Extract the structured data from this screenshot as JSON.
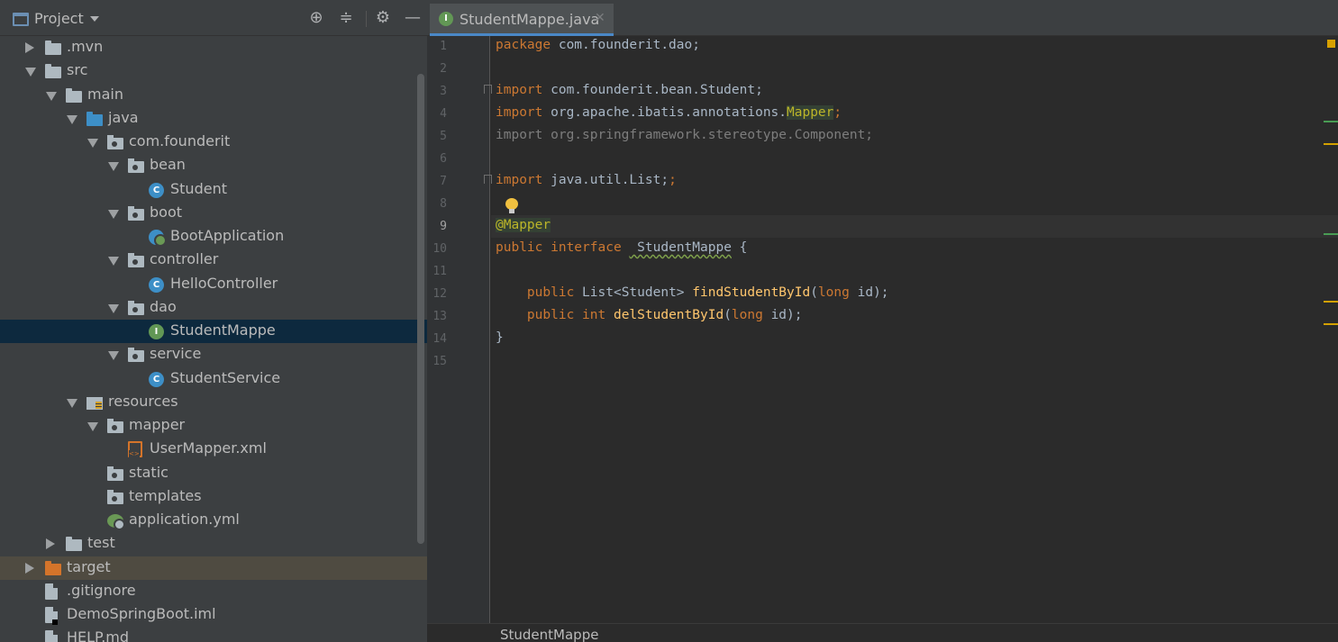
{
  "project_panel": {
    "title": "Project",
    "tree": [
      {
        "label": ".mvn",
        "depth": 0,
        "icon": "folder-icon",
        "arrow": "right"
      },
      {
        "label": "src",
        "depth": 0,
        "icon": "folder-icon",
        "arrow": "down"
      },
      {
        "label": "main",
        "depth": 1,
        "icon": "folder-icon",
        "arrow": "down"
      },
      {
        "label": "java",
        "depth": 2,
        "icon": "source-folder-icon",
        "arrow": "down"
      },
      {
        "label": "com.founderit",
        "depth": 3,
        "icon": "package-icon",
        "arrow": "down"
      },
      {
        "label": "bean",
        "depth": 4,
        "icon": "package-icon",
        "arrow": "down"
      },
      {
        "label": "Student",
        "depth": 5,
        "icon": "class-icon"
      },
      {
        "label": "boot",
        "depth": 4,
        "icon": "package-icon",
        "arrow": "down"
      },
      {
        "label": "BootApplication",
        "depth": 5,
        "icon": "spring-boot-class-icon"
      },
      {
        "label": "controller",
        "depth": 4,
        "icon": "package-icon",
        "arrow": "down"
      },
      {
        "label": "HelloController",
        "depth": 5,
        "icon": "class-icon"
      },
      {
        "label": "dao",
        "depth": 4,
        "icon": "package-icon",
        "arrow": "down"
      },
      {
        "label": "StudentMappe",
        "depth": 5,
        "icon": "interface-icon",
        "selected": true
      },
      {
        "label": "service",
        "depth": 4,
        "icon": "package-icon",
        "arrow": "down"
      },
      {
        "label": "StudentService",
        "depth": 5,
        "icon": "class-icon"
      },
      {
        "label": "resources",
        "depth": 2,
        "icon": "resources-folder-icon",
        "arrow": "down"
      },
      {
        "label": "mapper",
        "depth": 3,
        "icon": "package-icon",
        "arrow": "down"
      },
      {
        "label": "UserMapper.xml",
        "depth": 4,
        "icon": "xml-file-icon"
      },
      {
        "label": "static",
        "depth": 3,
        "icon": "package-icon"
      },
      {
        "label": "templates",
        "depth": 3,
        "icon": "package-icon"
      },
      {
        "label": "application.yml",
        "depth": 3,
        "icon": "yml-file-icon"
      },
      {
        "label": "test",
        "depth": 1,
        "icon": "folder-icon",
        "arrow": "right"
      },
      {
        "label": "target",
        "depth": 0,
        "icon": "excluded-folder-icon",
        "arrow": "right",
        "excluded": true
      },
      {
        "label": ".gitignore",
        "depth": 0,
        "icon": "gitignore-file-icon"
      },
      {
        "label": "DemoSpringBoot.iml",
        "depth": 0,
        "icon": "iml-file-icon"
      },
      {
        "label": "HELP.md",
        "depth": 0,
        "icon": "markdown-file-icon"
      }
    ]
  },
  "editor": {
    "tab_label": "StudentMappe.java",
    "current_line": 9,
    "line_numbers": [
      "1",
      "2",
      "3",
      "4",
      "5",
      "6",
      "7",
      "8",
      "9",
      "10",
      "11",
      "12",
      "13",
      "14",
      "15"
    ],
    "code": {
      "l1_kw": "package",
      "l1_rest": " com.founderit.dao;",
      "l3_kw": "import",
      "l3_rest": " com.founderit.bean.Student;",
      "l4_kw": "import",
      "l4_rest": " org.apache.ibatis.annotations.",
      "l4_hl": "Mapper",
      "l4_end": ";",
      "l5": "import org.springframework.stereotype.Component;",
      "l7_kw": "import",
      "l7_rest": " java.util.List;",
      "l9_ann": "@Mapper",
      "l10_kw1": "public",
      "l10_kw2": " interface",
      "l10_pre": " StudentMappe",
      "l10_brace": " {",
      "l12_kw": "public",
      "l12_type": " List<Student> ",
      "l12_fn": "findStudentById",
      "l12_open": "(",
      "l12_kw2": "long",
      "l12_end": " id);",
      "l13_kw": "public",
      "l13_kw2": " int",
      "l13_fn": " delStudentById",
      "l13_open": "(",
      "l13_kw3": "long",
      "l13_end": " id);",
      "l14": "}"
    },
    "breadcrumb": "StudentMappe",
    "colors": {
      "keyword": "#cc7832",
      "annotation": "#bbb529",
      "method": "#ffc66d",
      "text": "#a9b7c6"
    }
  }
}
